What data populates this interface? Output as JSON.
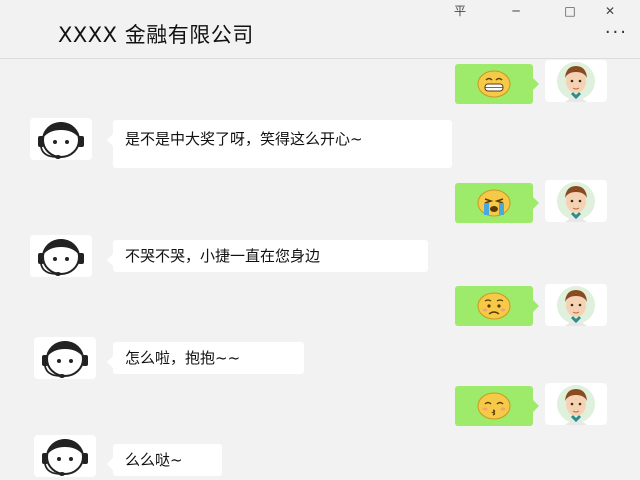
{
  "window": {
    "title": "XXXX 金融有限公司",
    "controls": {
      "pin": "平",
      "minimize": "─",
      "maximize": "□",
      "close": "✕"
    },
    "more_label": "···"
  },
  "messages": [
    {
      "side": "right",
      "kind": "emoji",
      "emoji_name": "grinning-face-icon"
    },
    {
      "side": "left",
      "kind": "text",
      "text": "是不是中大奖了呀，笑得这么开心~"
    },
    {
      "side": "right",
      "kind": "emoji",
      "emoji_name": "crying-face-icon"
    },
    {
      "side": "left",
      "kind": "text",
      "text": "不哭不哭，小捷一直在您身边"
    },
    {
      "side": "right",
      "kind": "emoji",
      "emoji_name": "worried-face-icon"
    },
    {
      "side": "left",
      "kind": "text",
      "text": "怎么啦，抱抱~~"
    },
    {
      "side": "right",
      "kind": "emoji",
      "emoji_name": "kissing-face-icon"
    },
    {
      "side": "left",
      "kind": "text",
      "text": "么么哒~"
    }
  ],
  "colors": {
    "background": "#f2f2f2",
    "self_bubble": "#9eea6a",
    "agent_bubble": "#ffffff",
    "emoji_yellow": "#f7c948"
  },
  "icons": {
    "agent_avatar": "customer-service-headset-avatar-icon",
    "user_avatar": "cartoon-man-avatar-icon"
  }
}
